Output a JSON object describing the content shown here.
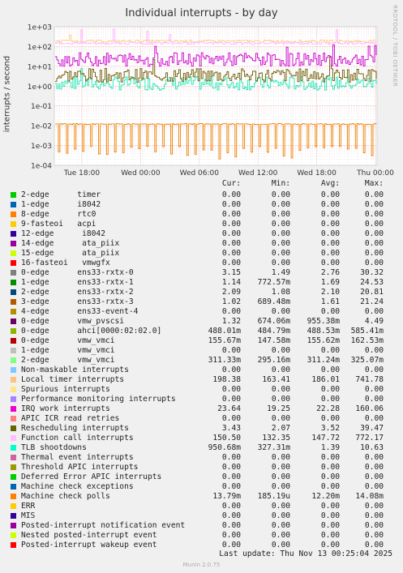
{
  "chart_data": {
    "type": "line",
    "title": "Individual interrupts - by day",
    "ylabel": "interrupts / second",
    "yscale": "log",
    "ylim": [
      0.0001,
      1000
    ],
    "y_ticks": [
      "1e+03",
      "1e+02",
      "1e+01",
      "1e+00",
      "1e-01",
      "1e-02",
      "1e-03",
      "1e-04"
    ],
    "x_ticks": [
      "Tue 18:00",
      "Wed 00:00",
      "Wed 06:00",
      "Wed 12:00",
      "Wed 18:00",
      "Thu 00:00"
    ],
    "grid": true,
    "series": [
      {
        "name": "TLB shootdowns",
        "color": "#1ee6b4",
        "cur": 0.95,
        "min": 0.327,
        "avg": 1.39,
        "max": 10.63
      },
      {
        "name": "Rescheduling interrupts",
        "color": "#6b5a00",
        "cur": 3.43,
        "min": 2.07,
        "avg": 3.52,
        "max": 39.47
      },
      {
        "name": "Local timer interrupts",
        "color": "#ffcc80",
        "cur": 198.38,
        "min": 163.41,
        "avg": 186.01,
        "max": 741.78
      },
      {
        "name": "Function call interrupts",
        "color": "#ffb3ff",
        "cur": 150.5,
        "min": 132.35,
        "avg": 147.72,
        "max": 772.17
      },
      {
        "name": "IRQ work interrupts",
        "color": "#cc00cc",
        "cur": 23.64,
        "min": 19.25,
        "avg": 22.28,
        "max": 160.06
      },
      {
        "name": "Machine check polls",
        "color": "#f08000",
        "cur": 0.01379,
        "min": 0.000185,
        "avg": 0.0122,
        "max": 0.01408
      }
    ]
  },
  "watermark": "RRDTOOL / TOBI OETIKER",
  "legend": {
    "headers": {
      "cur": "Cur:",
      "min": "Min:",
      "avg": "Avg:",
      "max": "Max:"
    },
    "rows": [
      {
        "label": "2-edge      timer",
        "color": "#00cc00",
        "cur": "0.00",
        "min": "0.00",
        "avg": "0.00",
        "max": "0.00"
      },
      {
        "label": "1-edge      i8042",
        "color": "#0066b3",
        "cur": "0.00",
        "min": "0.00",
        "avg": "0.00",
        "max": "0.00"
      },
      {
        "label": "8-edge      rtc0",
        "color": "#ff8000",
        "cur": "0.00",
        "min": "0.00",
        "avg": "0.00",
        "max": "0.00"
      },
      {
        "label": "9-fasteoi   acpi",
        "color": "#ffcc00",
        "cur": "0.00",
        "min": "0.00",
        "avg": "0.00",
        "max": "0.00"
      },
      {
        "label": "12-edge      i8042",
        "color": "#330099",
        "cur": "0.00",
        "min": "0.00",
        "avg": "0.00",
        "max": "0.00"
      },
      {
        "label": "14-edge      ata_piix",
        "color": "#990099",
        "cur": "0.00",
        "min": "0.00",
        "avg": "0.00",
        "max": "0.00"
      },
      {
        "label": "15-edge      ata_piix",
        "color": "#ccff00",
        "cur": "0.00",
        "min": "0.00",
        "avg": "0.00",
        "max": "0.00"
      },
      {
        "label": "16-fasteoi   vmwgfx",
        "color": "#ff0000",
        "cur": "0.00",
        "min": "0.00",
        "avg": "0.00",
        "max": "0.00"
      },
      {
        "label": "0-edge      ens33-rxtx-0",
        "color": "#808080",
        "cur": "3.15",
        "min": "1.49",
        "avg": "2.76",
        "max": "30.32"
      },
      {
        "label": "1-edge      ens33-rxtx-1",
        "color": "#008f00",
        "cur": "1.14",
        "min": "772.57m",
        "avg": "1.69",
        "max": "24.53"
      },
      {
        "label": "2-edge      ens33-rxtx-2",
        "color": "#00487d",
        "cur": "2.09",
        "min": "1.08",
        "avg": "2.10",
        "max": "20.81"
      },
      {
        "label": "3-edge      ens33-rxtx-3",
        "color": "#b35a00",
        "cur": "1.02",
        "min": "689.48m",
        "avg": "1.61",
        "max": "21.24"
      },
      {
        "label": "4-edge      ens33-event-4",
        "color": "#b38f00",
        "cur": "0.00",
        "min": "0.00",
        "avg": "0.00",
        "max": "0.00"
      },
      {
        "label": "0-edge      vmw_pvscsi",
        "color": "#6b006b",
        "cur": "1.32",
        "min": "674.06m",
        "avg": "955.38m",
        "max": "4.49"
      },
      {
        "label": "0-edge      ahci[0000:02:02.0]",
        "color": "#8fb300",
        "cur": "488.01m",
        "min": "484.79m",
        "avg": "488.53m",
        "max": "585.41m"
      },
      {
        "label": "0-edge      vmw_vmci",
        "color": "#b30000",
        "cur": "155.67m",
        "min": "147.58m",
        "avg": "155.62m",
        "max": "162.53m"
      },
      {
        "label": "1-edge      vmw_vmci",
        "color": "#bebebe",
        "cur": "0.00",
        "min": "0.00",
        "avg": "0.00",
        "max": "0.00"
      },
      {
        "label": "2-edge      vmw_vmci",
        "color": "#80ff80",
        "cur": "311.33m",
        "min": "295.16m",
        "avg": "311.24m",
        "max": "325.07m"
      },
      {
        "label": "Non-maskable interrupts",
        "color": "#80c9ff",
        "cur": "0.00",
        "min": "0.00",
        "avg": "0.00",
        "max": "0.00"
      },
      {
        "label": "Local timer interrupts",
        "color": "#ffc080",
        "cur": "198.38",
        "min": "163.41",
        "avg": "186.01",
        "max": "741.78"
      },
      {
        "label": "Spurious interrupts",
        "color": "#ffe680",
        "cur": "0.00",
        "min": "0.00",
        "avg": "0.00",
        "max": "0.00"
      },
      {
        "label": "Performance monitoring interrupts",
        "color": "#aa80ff",
        "cur": "0.00",
        "min": "0.00",
        "avg": "0.00",
        "max": "0.00"
      },
      {
        "label": "IRQ work interrupts",
        "color": "#ee00cc",
        "cur": "23.64",
        "min": "19.25",
        "avg": "22.28",
        "max": "160.06"
      },
      {
        "label": "APIC ICR read retries",
        "color": "#ff8080",
        "cur": "0.00",
        "min": "0.00",
        "avg": "0.00",
        "max": "0.00"
      },
      {
        "label": "Rescheduling interrupts",
        "color": "#666600",
        "cur": "3.43",
        "min": "2.07",
        "avg": "3.52",
        "max": "39.47"
      },
      {
        "label": "Function call interrupts",
        "color": "#ffbfff",
        "cur": "150.50",
        "min": "132.35",
        "avg": "147.72",
        "max": "772.17"
      },
      {
        "label": "TLB shootdowns",
        "color": "#00ffcc",
        "cur": "950.68m",
        "min": "327.31m",
        "avg": "1.39",
        "max": "10.63"
      },
      {
        "label": "Thermal event interrupts",
        "color": "#cc6699",
        "cur": "0.00",
        "min": "0.00",
        "avg": "0.00",
        "max": "0.00"
      },
      {
        "label": "Threshold APIC interrupts",
        "color": "#999900",
        "cur": "0.00",
        "min": "0.00",
        "avg": "0.00",
        "max": "0.00"
      },
      {
        "label": "Deferred Error APIC interrupts",
        "color": "#00cc00",
        "cur": "0.00",
        "min": "0.00",
        "avg": "0.00",
        "max": "0.00"
      },
      {
        "label": "Machine check exceptions",
        "color": "#0066b3",
        "cur": "0.00",
        "min": "0.00",
        "avg": "0.00",
        "max": "0.00"
      },
      {
        "label": "Machine check polls",
        "color": "#ff8000",
        "cur": "13.79m",
        "min": "185.19u",
        "avg": "12.20m",
        "max": "14.08m"
      },
      {
        "label": "ERR",
        "color": "#ffcc00",
        "cur": "0.00",
        "min": "0.00",
        "avg": "0.00",
        "max": "0.00"
      },
      {
        "label": "MIS",
        "color": "#330099",
        "cur": "0.00",
        "min": "0.00",
        "avg": "0.00",
        "max": "0.00"
      },
      {
        "label": "Posted-interrupt notification event",
        "color": "#990099",
        "cur": "0.00",
        "min": "0.00",
        "avg": "0.00",
        "max": "0.00"
      },
      {
        "label": "Nested posted-interrupt event",
        "color": "#ccff00",
        "cur": "0.00",
        "min": "0.00",
        "avg": "0.00",
        "max": "0.00"
      },
      {
        "label": "Posted-interrupt wakeup event",
        "color": "#ff0000",
        "cur": "0.00",
        "min": "0.00",
        "avg": "0.00",
        "max": "0.00"
      }
    ]
  },
  "last_update": "Last update: Thu Nov 13 00:25:04 2025",
  "footer": "Munin 2.0.75"
}
